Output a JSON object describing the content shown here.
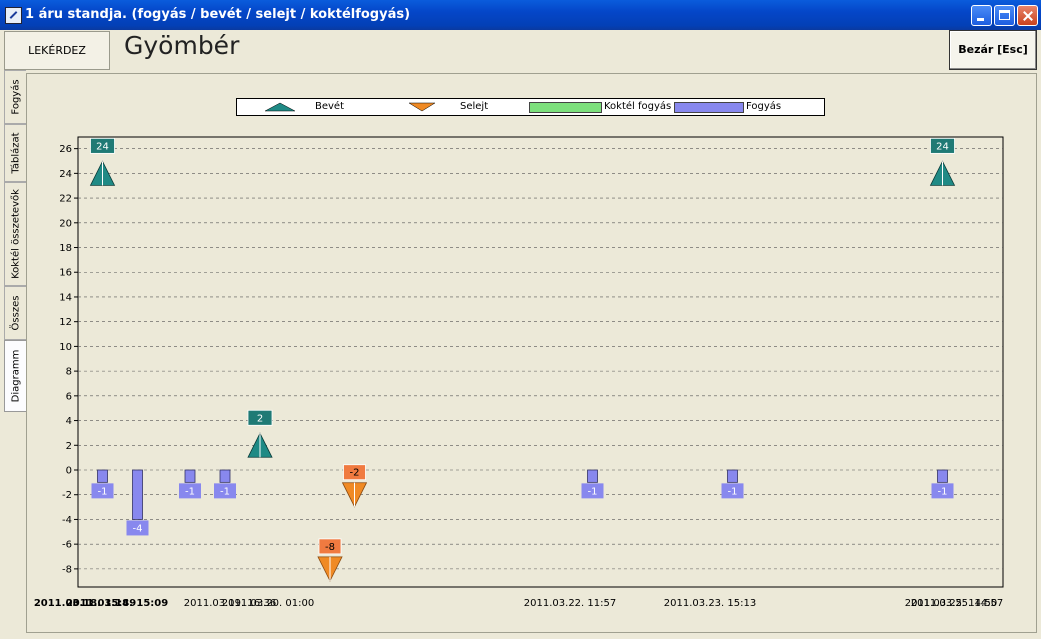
{
  "window": {
    "title": "1 áru standja. (fogyás / bevét / selejt / koktélfogyás)"
  },
  "header": {
    "query_label": "LEKÉRDEZ",
    "page_title": "Gyömbér",
    "close_label": "Bezár [Esc]"
  },
  "tabs": [
    {
      "label": "Fogyás",
      "active": false
    },
    {
      "label": "Táblázat",
      "active": false
    },
    {
      "label": "Koktél összetevők",
      "active": false
    },
    {
      "label": "Összes",
      "active": false
    },
    {
      "label": "Diagramm",
      "active": true
    }
  ],
  "colors": {
    "bevet": "#1f8a85",
    "selejt": "#f08a24",
    "koktel": "#7de07d",
    "fogyas": "#8888ee",
    "bevet_label_bg": "#1f7a75",
    "selejt_label_bg": "#f07a40"
  },
  "chart_data": {
    "type": "bar",
    "legend": [
      "Bevét",
      "Selejt",
      "Koktél fogyás",
      "Fogyás"
    ],
    "ylim": [
      -10,
      27
    ],
    "yticks": [
      26,
      24,
      22,
      20,
      18,
      16,
      14,
      12,
      10,
      8,
      6,
      4,
      2,
      0,
      -2,
      -4,
      -6,
      -8
    ],
    "xtick_labels": [
      {
        "text": "2011.03.18. 15:49",
        "bold": true
      },
      {
        "text": "2011.03.18. 15:09",
        "bold": true
      },
      {
        "text": "2011.03.19. 16:36",
        "bold": false
      },
      {
        "text": "2011.03.20. 01:00",
        "bold": false
      },
      {
        "text": "2011.03.22. 11:57",
        "bold": false
      },
      {
        "text": "2011.03.23. 15:13",
        "bold": false
      },
      {
        "text": "2011.03.25. 14:50",
        "bold": false
      },
      {
        "text": "2011.03.25. 14:57",
        "bold": false
      }
    ],
    "series": [
      {
        "name": "Bevét",
        "kind": "triangle-up",
        "points": [
          {
            "slot": 0.5,
            "value": 24,
            "label": "24"
          },
          {
            "slot": 5.0,
            "value": 2,
            "label": "2"
          },
          {
            "slot": 24.5,
            "value": 24,
            "label": "24"
          }
        ]
      },
      {
        "name": "Selejt",
        "kind": "triangle-down",
        "points": [
          {
            "slot": 7.0,
            "value": -8,
            "label": "-8"
          },
          {
            "slot": 7.7,
            "value": -2,
            "label": "-2"
          }
        ]
      },
      {
        "name": "Fogyás",
        "kind": "bar",
        "points": [
          {
            "slot": 0.5,
            "value": -1,
            "label": "-1"
          },
          {
            "slot": 1.5,
            "value": -4,
            "label": "-4"
          },
          {
            "slot": 3.0,
            "value": -1,
            "label": "-1"
          },
          {
            "slot": 4.0,
            "value": -1,
            "label": "-1"
          },
          {
            "slot": 14.5,
            "value": -1,
            "label": "-1"
          },
          {
            "slot": 18.5,
            "value": -1,
            "label": "-1"
          },
          {
            "slot": 24.5,
            "value": -1,
            "label": "-1"
          }
        ]
      }
    ]
  }
}
